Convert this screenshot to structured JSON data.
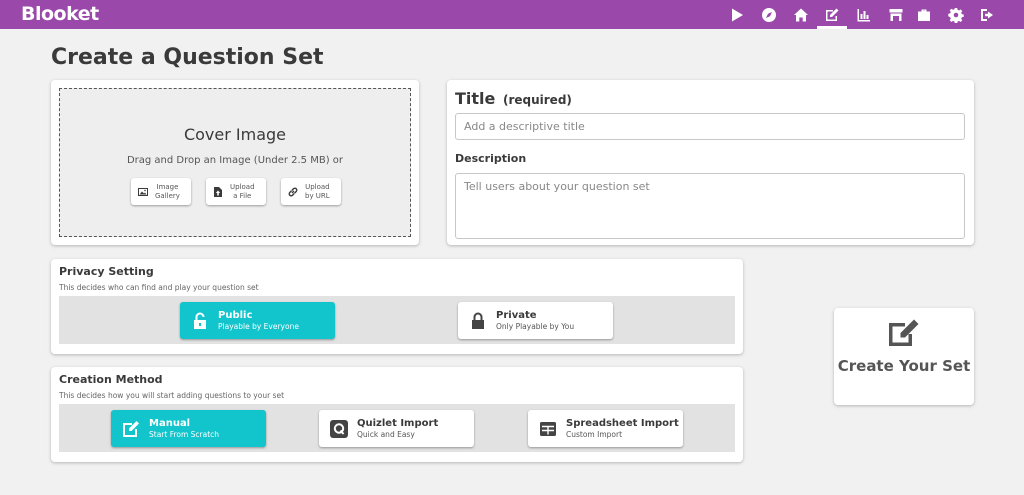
{
  "app": {
    "logo": "Blooket"
  },
  "nav": [
    {
      "icon": "play-icon"
    },
    {
      "icon": "compass-icon"
    },
    {
      "icon": "home-icon"
    },
    {
      "icon": "edit-icon",
      "active": true
    },
    {
      "icon": "stats-icon"
    },
    {
      "icon": "market-icon"
    },
    {
      "icon": "briefcase-icon"
    },
    {
      "icon": "gear-icon"
    },
    {
      "icon": "logout-icon"
    }
  ],
  "page": {
    "title": "Create a Question Set"
  },
  "cover": {
    "title": "Cover Image",
    "subtitle": "Drag and Drop an Image (Under 2.5 MB) or",
    "buttons": [
      {
        "label": "Image\nGallery",
        "icon": "image-icon"
      },
      {
        "label": "Upload\na File",
        "icon": "upload-file-icon"
      },
      {
        "label": "Upload\nby URL",
        "icon": "link-icon"
      }
    ]
  },
  "details": {
    "title_label": "Title",
    "title_required": "(required)",
    "title_placeholder": "Add a descriptive title",
    "title_value": "",
    "description_label": "Description",
    "description_placeholder": "Tell users about your question set",
    "description_value": ""
  },
  "privacy": {
    "title": "Privacy Setting",
    "subtitle": "This decides who can find and play your question set",
    "options": [
      {
        "label": "Public",
        "sublabel": "Playable by Everyone",
        "icon": "unlock-icon",
        "selected": true
      },
      {
        "label": "Private",
        "sublabel": "Only Playable by You",
        "icon": "lock-icon",
        "selected": false
      }
    ]
  },
  "creation": {
    "title": "Creation Method",
    "subtitle": "This decides how you will start adding questions to your set",
    "options": [
      {
        "label": "Manual",
        "sublabel": "Start From Scratch",
        "icon": "edit-icon",
        "selected": true
      },
      {
        "label": "Quizlet Import",
        "sublabel": "Quick and Easy",
        "icon": "quizlet-icon",
        "selected": false
      },
      {
        "label": "Spreadsheet Import",
        "sublabel": "Custom Import",
        "icon": "spreadsheet-icon",
        "selected": false
      }
    ]
  },
  "create_button": {
    "label": "Create Your Set",
    "icon": "edit-icon"
  },
  "colors": {
    "topbar": "#9a49aa",
    "accent": "#12c4cc",
    "background": "#f1f1f1"
  }
}
